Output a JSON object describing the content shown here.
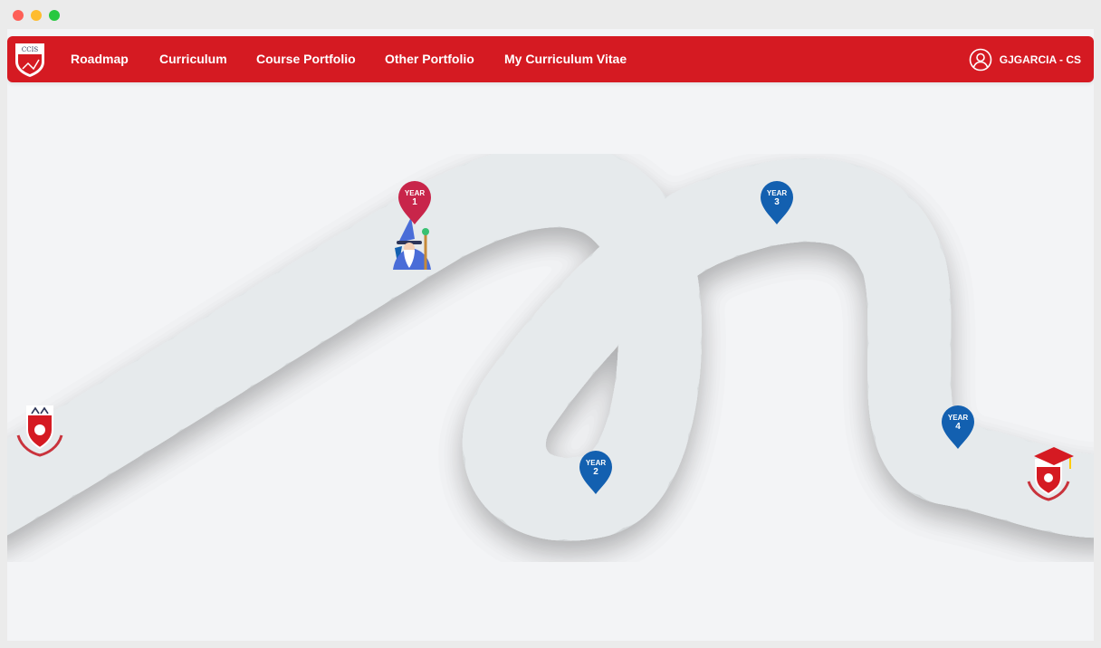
{
  "nav": {
    "logo_text": "CCIS",
    "links": [
      "Roadmap",
      "Curriculum",
      "Course Portfolio",
      "Other Portfolio",
      "My Curriculum Vitae"
    ],
    "user_label": "GJGARCIA - CS"
  },
  "roadmap": {
    "markers": [
      {
        "word": "YEAR",
        "num": "1",
        "color": "#c8254a"
      },
      {
        "word": "YEAR",
        "num": "2",
        "color": "#1360b0"
      },
      {
        "word": "YEAR",
        "num": "3",
        "color": "#1360b0"
      },
      {
        "word": "YEAR",
        "num": "4",
        "color": "#1360b0"
      }
    ],
    "road_color": "#2d3558",
    "shoulder_color": "#e6eaec"
  },
  "icons": [
    "ccis-logo-icon",
    "user-circle-icon",
    "wizard-icon",
    "university-crest-icon",
    "graduation-crest-icon"
  ]
}
